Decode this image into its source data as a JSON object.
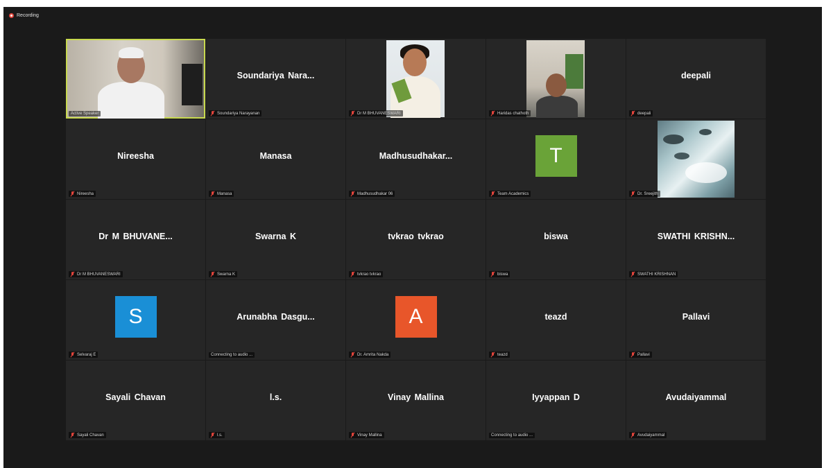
{
  "recording": {
    "label": "Recording"
  },
  "colors": {
    "background": "#1a1a1a",
    "tile": "#262626",
    "active_speaker_border": "#c8d94f",
    "muted": "#e2453c"
  },
  "participants": [
    {
      "display": "",
      "label": "Active Speaker",
      "video": "room",
      "muted": false
    },
    {
      "display": "Soundariya  Nara...",
      "label": "Soundariya Narayanan",
      "muted": true
    },
    {
      "display": "",
      "label": "Dr M BHUVANESWARI",
      "video": "woman",
      "muted": true
    },
    {
      "display": "",
      "label": "Haridas chathoth",
      "video": "man",
      "muted": true
    },
    {
      "display": "deepali",
      "label": "deepali",
      "muted": true
    },
    {
      "display": "Nireesha",
      "label": "Nireesha",
      "muted": true
    },
    {
      "display": "Manasa",
      "label": "Manasa",
      "muted": true
    },
    {
      "display": "Madhusudhakar...",
      "label": "Madhusudhakar 06",
      "muted": true
    },
    {
      "display": "",
      "label": "Team Academics",
      "avatar_letter": "T",
      "avatar_color": "#6aa338",
      "muted": true
    },
    {
      "display": "",
      "label": "Dr. Sreejith",
      "video": "sea",
      "muted": true
    },
    {
      "display": "Dr  M  BHUVANE...",
      "label": "Dr M BHUVANESWARI",
      "muted": true
    },
    {
      "display": "Swarna K",
      "label": "Swarna K",
      "muted": true
    },
    {
      "display": "tvkrao tvkrao",
      "label": "tvkrao tvkrao",
      "muted": true
    },
    {
      "display": "biswa",
      "label": "biswa",
      "muted": true
    },
    {
      "display": "SWATHI  KRISHN...",
      "label": "SWATHI KRISHNAN",
      "muted": true
    },
    {
      "display": "",
      "label": "Selvaraj E",
      "avatar_letter": "S",
      "avatar_color": "#1a8fd6",
      "muted": true
    },
    {
      "display": "Arunabha  Dasgu...",
      "label": "Connecting to audio ...",
      "muted": false
    },
    {
      "display": "",
      "label": "Dr. Amrita Nakda",
      "avatar_letter": "A",
      "avatar_color": "#e8562a",
      "muted": true
    },
    {
      "display": "teazd",
      "label": "teazd",
      "muted": true
    },
    {
      "display": "Pallavi",
      "label": "Pallavi",
      "muted": true
    },
    {
      "display": "Sayali Chavan",
      "label": "Sayali Chavan",
      "muted": true
    },
    {
      "display": "l.s.",
      "label": "l.s.",
      "muted": true
    },
    {
      "display": "Vinay Mallina",
      "label": "Vinay Mallina",
      "muted": true
    },
    {
      "display": "Iyyappan D",
      "label": "Connecting to audio ...",
      "muted": false
    },
    {
      "display": "Avudaiyammal",
      "label": "Avudaiyammal",
      "muted": true
    }
  ]
}
